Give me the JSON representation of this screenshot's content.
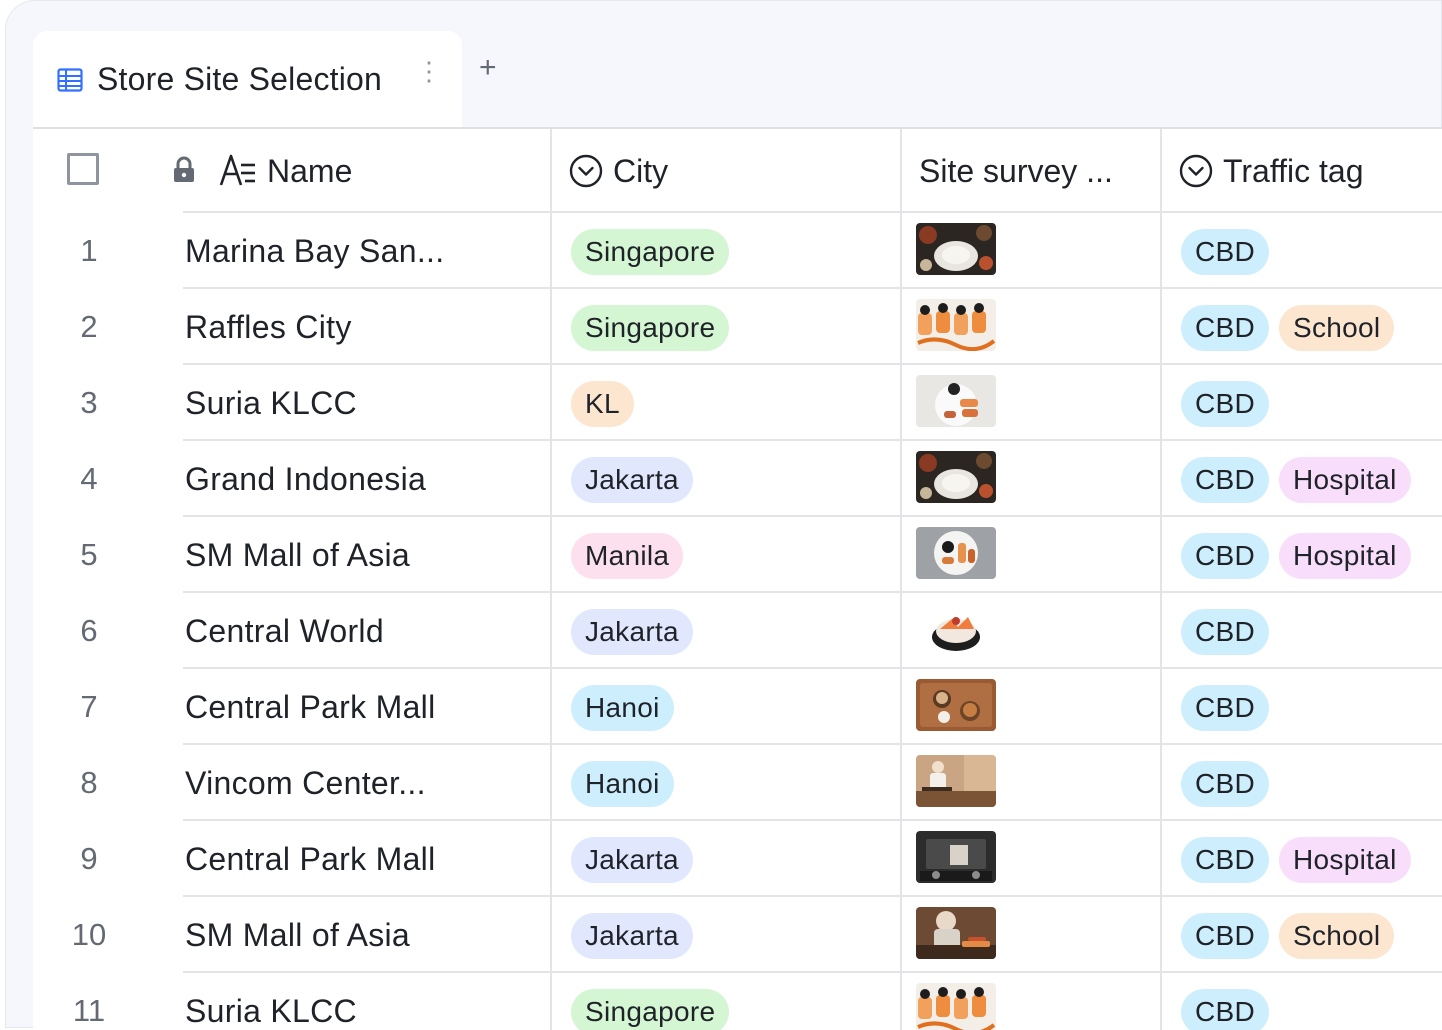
{
  "tab": {
    "title": "Store Site Selection",
    "more": "⋮",
    "add": "+"
  },
  "columns": {
    "name": "Name",
    "city": "City",
    "survey": "Site survey ...",
    "traffic": "Traffic tag"
  },
  "colors": {
    "Singapore": "#d5f6d3",
    "KL": "#fde6cf",
    "Jakarta": "#e1e7fd",
    "Manila": "#fce0ee",
    "Hanoi": "#cdeffd",
    "CBD": "#cdeffd",
    "School": "#fde6cf",
    "Hospital": "#f8defa"
  },
  "rows": [
    {
      "num": "1",
      "name": "Marina Bay San...",
      "city": "Singapore",
      "photo": "food-plate-rice",
      "tags": [
        "CBD"
      ]
    },
    {
      "num": "2",
      "name": "Raffles City",
      "city": "Singapore",
      "photo": "sushi-rolls",
      "tags": [
        "CBD",
        "School"
      ]
    },
    {
      "num": "3",
      "name": "Suria KLCC",
      "city": "KL",
      "photo": "sushi-plate-white",
      "tags": [
        "CBD"
      ]
    },
    {
      "num": "4",
      "name": "Grand Indonesia",
      "city": "Jakarta",
      "photo": "food-plate-rice",
      "tags": [
        "CBD",
        "Hospital"
      ]
    },
    {
      "num": "5",
      "name": "SM Mall of Asia",
      "city": "Manila",
      "photo": "sushi-plate-grey",
      "tags": [
        "CBD",
        "Hospital"
      ]
    },
    {
      "num": "6",
      "name": "Central World",
      "city": "Jakarta",
      "photo": "sushi-bowl",
      "tags": [
        "CBD"
      ]
    },
    {
      "num": "7",
      "name": "Central Park Mall",
      "city": "Hanoi",
      "photo": "wooden-tray",
      "tags": [
        "CBD"
      ]
    },
    {
      "num": "8",
      "name": "Vincom Center...",
      "city": "Hanoi",
      "photo": "chef-counter",
      "tags": [
        "CBD"
      ]
    },
    {
      "num": "9",
      "name": "Central Park Mall",
      "city": "Jakarta",
      "photo": "kitchen-dark",
      "tags": [
        "CBD",
        "Hospital"
      ]
    },
    {
      "num": "10",
      "name": "SM Mall of Asia",
      "city": "Jakarta",
      "photo": "chef-cooking",
      "tags": [
        "CBD",
        "School"
      ]
    },
    {
      "num": "11",
      "name": "Suria KLCC",
      "city": "Singapore",
      "photo": "sushi-rolls",
      "tags": [
        "CBD"
      ]
    }
  ]
}
